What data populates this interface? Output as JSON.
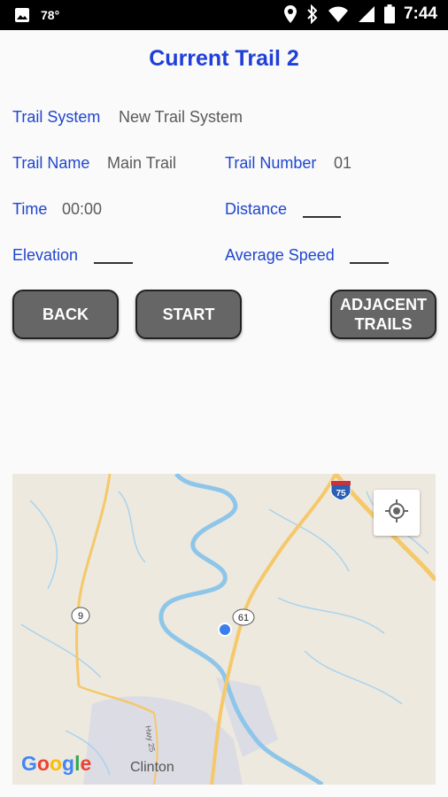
{
  "status_bar": {
    "temperature": "78°",
    "time": "7:44",
    "icons": [
      "image-icon",
      "location-icon",
      "bluetooth-icon",
      "wifi-icon",
      "signal-icon",
      "battery-icon"
    ]
  },
  "page": {
    "title": "Current Trail 2"
  },
  "fields": {
    "trail_system_label": "Trail System",
    "trail_system_value": "New Trail System",
    "trail_name_label": "Trail Name",
    "trail_name_value": "Main Trail",
    "trail_number_label": "Trail Number",
    "trail_number_value": "01",
    "time_label": "Time",
    "time_value": "00:00",
    "distance_label": "Distance",
    "elevation_label": "Elevation",
    "average_speed_label": "Average Speed"
  },
  "buttons": {
    "back": "BACK",
    "start": "START",
    "adjacent_line1": "ADJACENT",
    "adjacent_line2": "TRAILS"
  },
  "map": {
    "place_label": "Clinton",
    "route_shields": [
      "9",
      "61",
      "75"
    ],
    "road_label": "Hwy 25",
    "attribution_letters": [
      "G",
      "o",
      "o",
      "g",
      "l",
      "e"
    ],
    "colors": {
      "land": "#ede9df",
      "water": "#8ec6ea",
      "highway": "#f5c86a",
      "urban": "#dcdce4",
      "location_dot": "#3b7ded"
    }
  }
}
